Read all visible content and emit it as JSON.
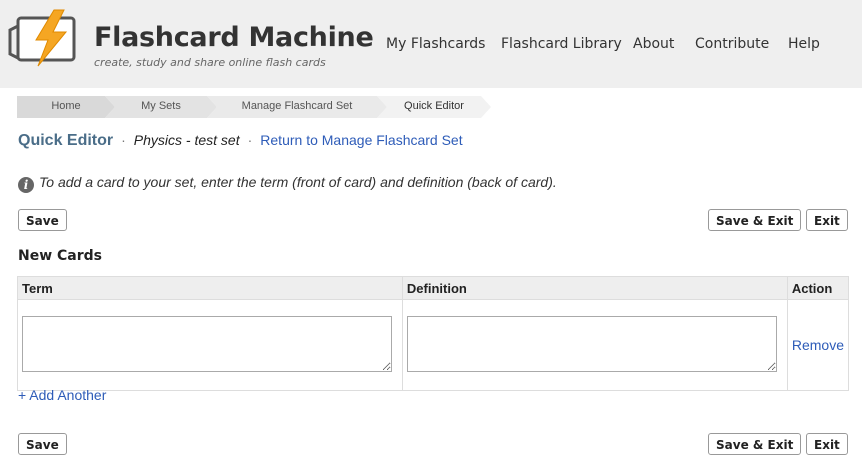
{
  "header": {
    "title": "Flashcard Machine",
    "tagline": "create, study and share online flash cards",
    "nav": [
      "My Flashcards",
      "Flashcard Library",
      "About",
      "Contribute",
      "Help"
    ]
  },
  "breadcrumb": [
    "Home",
    "My Sets",
    "Manage Flashcard Set",
    "Quick Editor"
  ],
  "page": {
    "title": "Quick Editor",
    "separator": "·",
    "set_name": "Physics - test set",
    "return_link": "Return to Manage Flashcard Set",
    "info_text": "To add a card to your set, enter the term (front of card) and definition (back of card).",
    "info_icon_glyph": "i"
  },
  "buttons": {
    "save": "Save",
    "save_exit": "Save & Exit",
    "exit": "Exit"
  },
  "new_cards": {
    "section_title": "New Cards",
    "columns": [
      "Term",
      "Definition",
      "Action"
    ],
    "rows": [
      {
        "term": "",
        "definition": "",
        "action": "Remove"
      }
    ],
    "add_another": "+ Add Another"
  },
  "colors": {
    "accent_link": "#2e5cb8",
    "title_blue": "#4a6d88",
    "logo_orange": "#f5a623"
  }
}
